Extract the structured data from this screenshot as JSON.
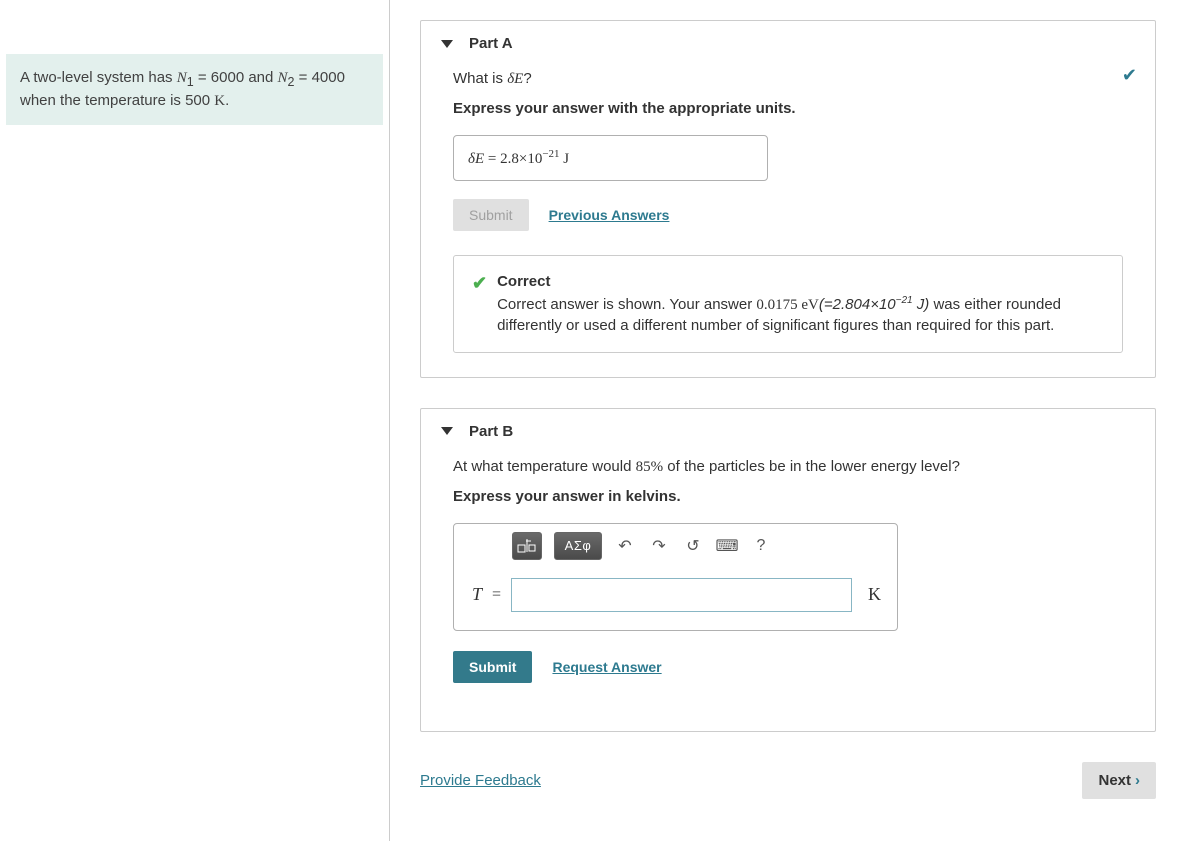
{
  "problem": {
    "text_pre": "A two-level system has ",
    "n1_sym": "N",
    "n1_sub": "1",
    "n1_eq": " = 6000 and ",
    "n2_sym": "N",
    "n2_sub": "2",
    "n2_eq": " = 4000 when the temperature is 500 ",
    "unit_k": "K",
    "period": "."
  },
  "partA": {
    "title": "Part A",
    "question_pre": "What is ",
    "delta": "δE",
    "question_post": "?",
    "instruction": "Express your answer with the appropriate units.",
    "answer_prefix": "δE",
    "answer_eq": " = ",
    "answer_val": "2.8×10",
    "answer_exp": "−21",
    "answer_unit": " J",
    "submit": "Submit",
    "prev": "Previous Answers",
    "correct": "Correct",
    "fb_pre": "Correct answer is shown. Your answer ",
    "fb_val": "0.0175 eV",
    "fb_par_open": "(=",
    "fb_conv": "2.804×10",
    "fb_exp": "−21",
    "fb_conv_unit": " J",
    "fb_par_close": ")",
    "fb_post": " was either rounded differently or used a different number of significant figures than required for this part."
  },
  "partB": {
    "title": "Part B",
    "question_pre": "At what temperature would ",
    "percent": "85%",
    "question_post": " of the particles be in the lower energy level?",
    "instruction": "Express your answer in kelvins.",
    "greek_btn": "ΑΣφ",
    "var": "T",
    "eq": "=",
    "unit": "K",
    "submit": "Submit",
    "request": "Request Answer"
  },
  "footer": {
    "feedback": "Provide Feedback",
    "next": "Next"
  }
}
